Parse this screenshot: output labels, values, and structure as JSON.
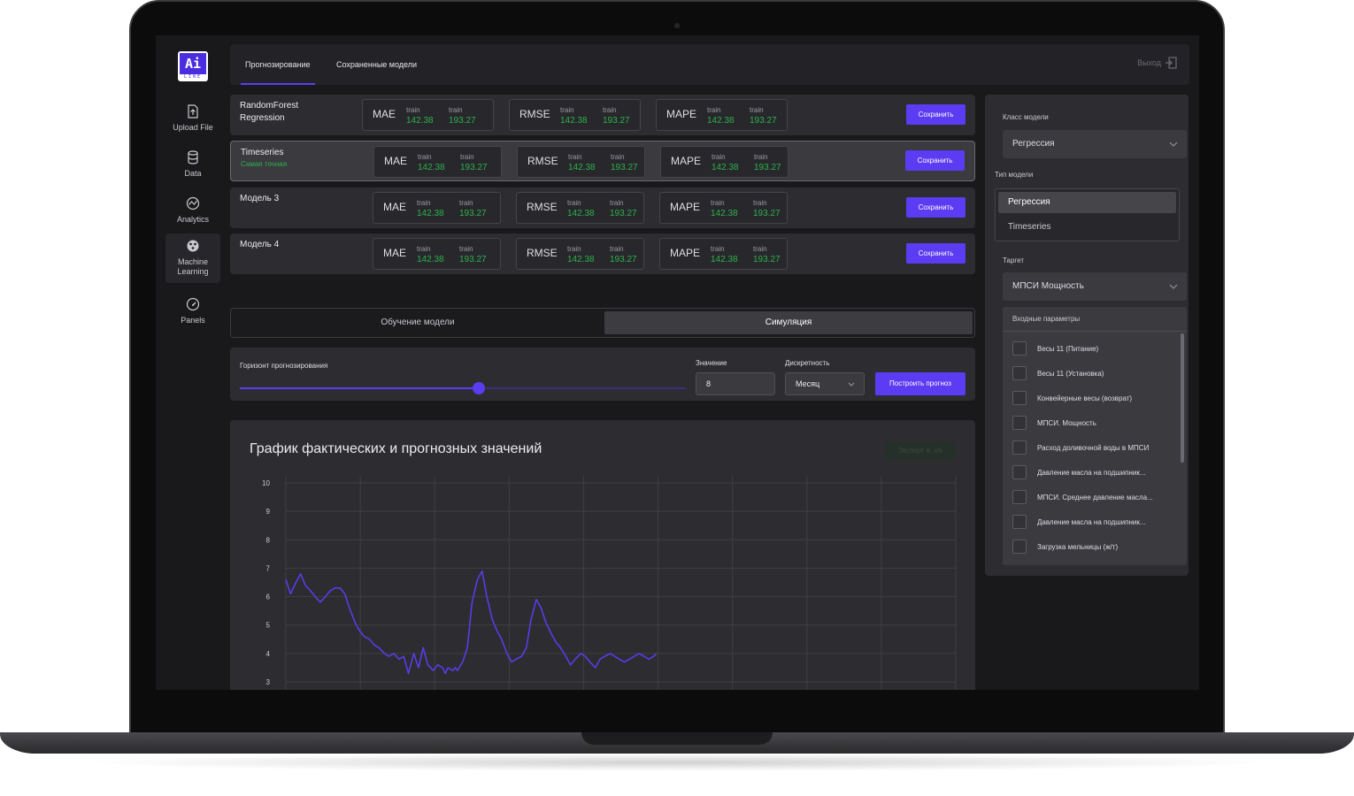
{
  "logo": {
    "main": "Ai",
    "sub": "LINE"
  },
  "nav": [
    {
      "label": "Upload File",
      "icon": "upload-file-icon",
      "active": false
    },
    {
      "label": "Data",
      "icon": "database-icon",
      "active": false
    },
    {
      "label": "Analytics",
      "icon": "analytics-icon",
      "active": false
    },
    {
      "label": "Machine Learning",
      "icon": "brain-icon",
      "active": true
    },
    {
      "label": "Panels",
      "icon": "gauge-icon",
      "active": false
    }
  ],
  "topbar": {
    "tabs": [
      {
        "label": "Прогнозирование",
        "active": true
      },
      {
        "label": "Сохраненные модели",
        "active": false
      }
    ],
    "logout_label": "Выход"
  },
  "models": [
    {
      "name": "RandomForest Regression",
      "subtitle": "",
      "active": false
    },
    {
      "name": "Timeseries",
      "subtitle": "Самая точная",
      "active": true
    },
    {
      "name": "Модель 3",
      "subtitle": "",
      "active": false
    },
    {
      "name": "Модель 4",
      "subtitle": "",
      "active": false
    }
  ],
  "metrics": [
    {
      "name": "MAE",
      "col1_label": "train",
      "col1_value": "142.38",
      "col2_label": "train",
      "col2_value": "193.27"
    },
    {
      "name": "RMSE",
      "col1_label": "train",
      "col1_value": "142.38",
      "col2_label": "train",
      "col2_value": "193.27"
    },
    {
      "name": "MAPE",
      "col1_label": "train",
      "col1_value": "142.38",
      "col2_label": "train",
      "col2_value": "193.27"
    }
  ],
  "save_label": "Сохранить",
  "mode_toggle": {
    "train_label": "Обучение модели",
    "simulate_label": "Симуляция",
    "active": "simulate"
  },
  "horizon": {
    "label": "Горизонт прогнозирования",
    "slider_fraction": 0.535,
    "value_label": "Значение",
    "value": "8",
    "discreteness_label": "Дискретность",
    "discreteness_value": "Месяц",
    "build_label": "Построить прогноз"
  },
  "chart_title": "График фактических и прогнозных значений",
  "export_label": "Экспорт в .xls",
  "chart_data": {
    "type": "line",
    "title": "График фактических и прогнозных значений",
    "ylim": [
      3,
      10
    ],
    "yticks": [
      10,
      9,
      8,
      7,
      6,
      5,
      4,
      3
    ],
    "xlim": [
      0,
      1
    ],
    "grid": true,
    "color": "#5b3cf2",
    "series": [
      {
        "name": "",
        "x": [
          0.0,
          0.007,
          0.015,
          0.022,
          0.029,
          0.037,
          0.044,
          0.051,
          0.059,
          0.066,
          0.073,
          0.081,
          0.088,
          0.095,
          0.103,
          0.11,
          0.117,
          0.125,
          0.132,
          0.139,
          0.147,
          0.154,
          0.161,
          0.169,
          0.176,
          0.183,
          0.191,
          0.198,
          0.205,
          0.212,
          0.22,
          0.227,
          0.234,
          0.238,
          0.242,
          0.249,
          0.253,
          0.256,
          0.261,
          0.264,
          0.271,
          0.278,
          0.286,
          0.293,
          0.3,
          0.308,
          0.315,
          0.322,
          0.33,
          0.337,
          0.344,
          0.352,
          0.359,
          0.366,
          0.374,
          0.381,
          0.388,
          0.396,
          0.403,
          0.41,
          0.418,
          0.425,
          0.432,
          0.44,
          0.447,
          0.454,
          0.462,
          0.469,
          0.476,
          0.484,
          0.491,
          0.498,
          0.505,
          0.513,
          0.52,
          0.527,
          0.535,
          0.542,
          0.549,
          0.553
        ],
        "y": [
          6.6,
          6.1,
          6.5,
          6.8,
          6.4,
          6.2,
          6.0,
          5.8,
          6.0,
          6.2,
          6.3,
          6.3,
          6.1,
          5.6,
          5.1,
          4.8,
          4.6,
          4.5,
          4.3,
          4.2,
          4.0,
          3.9,
          4.0,
          3.8,
          3.9,
          3.3,
          4.0,
          3.5,
          4.2,
          3.6,
          3.4,
          3.6,
          3.5,
          3.3,
          3.5,
          3.4,
          3.5,
          3.4,
          3.6,
          3.7,
          4.2,
          5.8,
          6.6,
          6.9,
          6.0,
          5.2,
          4.8,
          4.5,
          4.0,
          3.7,
          3.8,
          3.9,
          4.2,
          5.2,
          5.9,
          5.6,
          5.1,
          4.7,
          4.4,
          4.2,
          3.9,
          3.6,
          3.8,
          4.0,
          3.9,
          3.7,
          3.5,
          3.8,
          3.9,
          4.0,
          3.9,
          3.8,
          3.7,
          3.8,
          3.9,
          4.0,
          3.9,
          3.8,
          3.9,
          4.0
        ]
      }
    ]
  },
  "right_panel": {
    "model_class_label": "Класс модели",
    "model_class_value": "Регрессия",
    "model_type_label": "Тип модели",
    "model_type_options": [
      {
        "label": "Регрессия",
        "active": true
      },
      {
        "label": "Timeseries",
        "active": false
      }
    ],
    "target_label": "Таргет",
    "target_value": "МПСИ Мощность",
    "inputs_header": "Входные параметры",
    "inputs": [
      "Весы 11 (Питание)",
      "Весы 11 (Установка)",
      "Конвейерные весы (возврат)",
      "МПСИ. Мощность",
      "Расход доливочной воды в МПСИ",
      "Давление масла на подшипник...",
      "МПСИ. Среднее давление масла...",
      "Давление масла на подшипник...",
      "Загрузка мельницы (ж/т)"
    ]
  }
}
